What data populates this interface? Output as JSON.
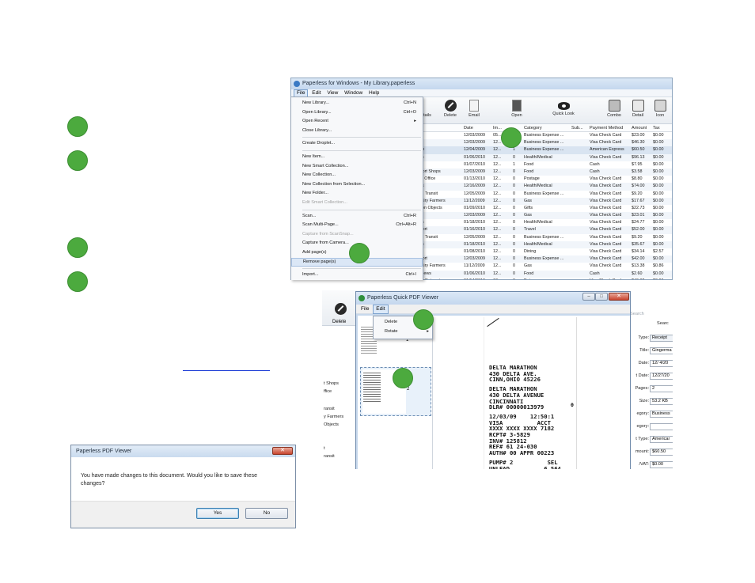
{
  "main_window": {
    "title": "Paperless for Windows - My Library.paperless",
    "menus": [
      "File",
      "Edit",
      "View",
      "Window",
      "Help"
    ],
    "toolbar": [
      "tails",
      "Delete",
      "Email",
      "Open",
      "Quick Look",
      "Combo",
      "Detail",
      "Icon"
    ],
    "columns": [
      "Date",
      "Im...",
      "",
      "Category",
      "Sub...",
      "Payment Method",
      "Amount",
      "Tax"
    ],
    "rows": [
      [
        "thon",
        "12/03/2009",
        "05...",
        "",
        "Business Expense ...",
        "",
        "Visa Check Card",
        "$23.00",
        "$0.00"
      ],
      [
        "Taxi",
        "12/03/2009",
        "12...",
        "0",
        "Business Expense ...",
        "",
        "Visa Check Card",
        "$46.30",
        "$0.00"
      ],
      [
        "rmen",
        "12/04/2009",
        "12...",
        "1",
        "Business Expense ...",
        "",
        "American Express",
        "$60.50",
        "$0.00"
      ],
      [
        "eens",
        "01/06/2010",
        "12...",
        "0",
        "Health/Medical",
        "",
        "Visa Check Card",
        "$96.13",
        "$0.00"
      ],
      [
        "ucks",
        "01/07/2010",
        "12...",
        "1",
        "Food",
        "",
        "Cash",
        "$7.95",
        "$0.00"
      ],
      [
        " Airport Shops",
        "12/03/2009",
        "12...",
        "0",
        "Food",
        "",
        "Cash",
        "$3.58",
        "$0.00"
      ],
      [
        "Post Office",
        "01/13/2010",
        "12...",
        "0",
        "Postage",
        "",
        "Visa Check Card",
        "$8.80",
        "$0.00"
      ],
      [
        "eens",
        "12/16/2009",
        "12...",
        "0",
        "Health/Medical",
        "",
        "Visa Check Card",
        "$74.00",
        "$0.00"
      ],
      [
        "NYC Transit",
        "12/05/2009",
        "12...",
        "0",
        "Business Expense ...",
        "",
        "Visa Check Card",
        "$9.20",
        "$0.00"
      ],
      [
        "d Dairy Farmers",
        "11/12/2009",
        "12...",
        "0",
        "Gas",
        "",
        "Visa Check Card",
        "$17.67",
        "$0.00"
      ],
      [
        "mmon Objects",
        "01/09/2010",
        "12...",
        "0",
        "Gifts",
        "",
        "Visa Check Card",
        "$22.73",
        "$0.00"
      ],
      [
        "thon",
        "12/03/2009",
        "12...",
        "0",
        "Gas",
        "",
        "Visa Check Card",
        "$23.01",
        "$0.00"
      ],
      [
        "eens",
        "01/18/2010",
        "12...",
        "0",
        "Health/Medical",
        "",
        "Visa Check Card",
        "$24.77",
        "$0.00"
      ],
      [
        "Airport",
        "01/16/2010",
        "12...",
        "0",
        "Travel",
        "",
        "Visa Check Card",
        "$52.00",
        "$0.00"
      ],
      [
        "NYC Transit",
        "12/05/2009",
        "12...",
        "0",
        "Business Expense ...",
        "",
        "Visa Check Card",
        "$9.20",
        "$0.00"
      ],
      [
        "eens",
        "01/18/2010",
        "12...",
        "0",
        "Health/Medical",
        "",
        "Visa Check Card",
        "$35.67",
        "$0.00"
      ],
      [
        "n",
        "01/08/2010",
        "12...",
        "0",
        "Dining",
        "",
        "Visa Check Card",
        "$34.14",
        "$2.57"
      ],
      [
        "Airport",
        "12/03/2009",
        "12...",
        "0",
        "Business Expense ...",
        "",
        "Visa Check Card",
        "$42.00",
        "$0.00"
      ],
      [
        "d Dairy Farmers",
        "11/12/2009",
        "12...",
        "0",
        "Gas",
        "",
        "Visa Check Card",
        "$13.38",
        "$0.86"
      ],
      [
        "on News",
        "01/06/2010",
        "12...",
        "0",
        "Food",
        "",
        "Cash",
        "$2.60",
        "$0.00"
      ],
      [
        "olete Petmart",
        "01/14/2010",
        "12...",
        "0",
        "Pets",
        "",
        "Visa Check Card",
        "$49.82",
        "$0.00"
      ]
    ]
  },
  "file_menu": [
    {
      "label": "New Library...",
      "shortcut": "Ctrl+N"
    },
    {
      "label": "Open Library...",
      "shortcut": "Ctrl+O"
    },
    {
      "label": "Open Recent",
      "shortcut": "▸"
    },
    {
      "label": "Close Library..."
    },
    {
      "sep": true
    },
    {
      "label": "Create Droplet..."
    },
    {
      "sep": true
    },
    {
      "label": "New Item..."
    },
    {
      "label": "New Smart Collection..."
    },
    {
      "label": "New Collection..."
    },
    {
      "label": "New Collection from Selection..."
    },
    {
      "label": "New Folder..."
    },
    {
      "label": "Edit Smart Collection...",
      "disabled": true
    },
    {
      "sep": true
    },
    {
      "label": "Scan...",
      "shortcut": "Ctrl+R"
    },
    {
      "label": "Scan Multi-Page...",
      "shortcut": "Ctrl+Alt+R"
    },
    {
      "label": "Capture from ScanSnap...",
      "disabled": true
    },
    {
      "label": "Capture from Camera..."
    },
    {
      "label": "Add page(s)"
    },
    {
      "label": "Remove page(s)",
      "highlight": true
    },
    {
      "sep": true
    },
    {
      "label": "Import...",
      "shortcut": "Ctrl+I"
    }
  ],
  "quick_viewer": {
    "title": "Paperless Quick PDF Viewer",
    "menus": [
      "File",
      "Edit"
    ],
    "edit_menu": [
      {
        "label": "Delete"
      },
      {
        "label": "Rotate",
        "arrow": "▸"
      }
    ],
    "thumb_labels": [
      "1",
      "2"
    ],
    "receipt_lines": [
      "DELTA MARATHON",
      "430 DELTA AVE.",
      "CINN,OHIO 45226",
      "",
      "DELTA MARATHON",
      "430 DELTA AVENUE",
      "CINCINNATI",
      "DLR# 00000013979",
      "",
      "12/03/09    12:50:1",
      "VISA          ACCT",
      "XXXX XXXX XXXX 7182",
      "RCPT# 3-5829",
      "INV# 125812",
      "REF# 61 24-030",
      "AUTH# 00 APPR 00223",
      "",
      "PUMP# 2          SEL",
      "UNLEAD          6.564"
    ],
    "receipt_right_char": "0"
  },
  "behind_left": {
    "toolbar_delete": "Delete",
    "list_fragments": [
      "t Shops",
      "ffice",
      "ransit",
      "y Farmers",
      "Objects",
      "t",
      "ransit"
    ]
  },
  "behind_right": {
    "search": "Search",
    "search_btn": "Searc",
    "fields": [
      {
        "label": "Type:",
        "value": "Receipt"
      },
      {
        "label": "Title:",
        "value": "Gingerma"
      },
      {
        "label": "Date:",
        "value": "12/ 4/20"
      },
      {
        "label": "t Date:",
        "value": "12/27/20"
      },
      {
        "label": "Pages:",
        "value": "2"
      },
      {
        "label": "Size:",
        "value": "53.2 KB"
      },
      {
        "label": "egory:",
        "value": "Business"
      },
      {
        "label": "egory:",
        "value": ""
      },
      {
        "label": "t Type:",
        "value": "Americar"
      },
      {
        "label": "mount:",
        "value": "$60.50"
      },
      {
        "label": "/VAT:",
        "value": "$0.00"
      }
    ]
  },
  "save_dialog": {
    "title": "Paperless PDF Viewer",
    "message": "You have made changes to this document.  Would you like to save these changes?",
    "yes": "Yes",
    "no": "No",
    "close": "✕"
  },
  "colors": {
    "step_dot": "#4caa3e",
    "link": "#1f3ed6"
  }
}
